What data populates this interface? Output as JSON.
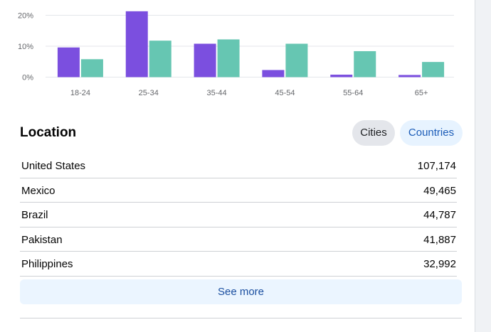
{
  "colors": {
    "series_primary": "#7b4fdf",
    "series_secondary": "#66c6b2",
    "grid": "#e4e6eb",
    "axis_text": "#65676b"
  },
  "chart_data": {
    "type": "bar",
    "categories": [
      "18-24",
      "25-34",
      "35-44",
      "45-54",
      "55-64",
      "65+"
    ],
    "series": [
      {
        "values": [
          9.6,
          21.3,
          10.8,
          2.3,
          0.8,
          0.7
        ]
      },
      {
        "values": [
          5.8,
          11.8,
          12.2,
          10.8,
          8.4,
          4.9
        ]
      }
    ],
    "yticks": [
      "0%",
      "10%",
      "20%"
    ],
    "ylim": [
      0,
      20
    ],
    "title": "",
    "xlabel": "",
    "ylabel": ""
  },
  "location": {
    "title": "Location",
    "toggle_cities": "Cities",
    "toggle_countries": "Countries",
    "selected": "Countries",
    "rows": [
      {
        "name": "United States",
        "value": "107,174"
      },
      {
        "name": "Mexico",
        "value": "49,465"
      },
      {
        "name": "Brazil",
        "value": "44,787"
      },
      {
        "name": "Pakistan",
        "value": "41,887"
      },
      {
        "name": "Philippines",
        "value": "32,992"
      }
    ],
    "see_more": "See more"
  }
}
